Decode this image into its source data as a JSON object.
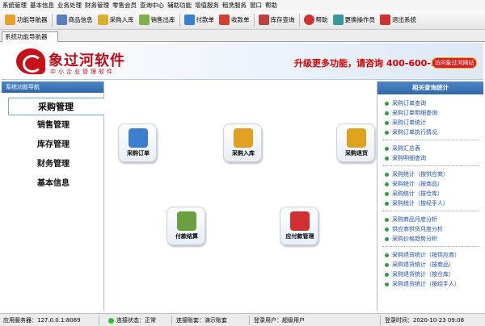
{
  "menu": [
    "系统管理",
    "基本信息",
    "业务处理",
    "财务管理",
    "零售会员",
    "查询中心",
    "辅助功能",
    "增值服务",
    "租赁服务",
    "窗口",
    "帮助"
  ],
  "toolbar": [
    {
      "label": "功能导航器",
      "icon": "home-icon",
      "color": "#e8a030"
    },
    {
      "label": "商品信息",
      "icon": "product-list-icon",
      "color": "#5a7fc0"
    },
    {
      "label": "采购入库",
      "icon": "purchase-in-icon",
      "color": "#d8b030"
    },
    {
      "label": "销售出库",
      "icon": "sales-out-icon",
      "color": "#7fb04a"
    },
    {
      "label": "付款单",
      "icon": "payment-icon",
      "color": "#3a7fd0"
    },
    {
      "label": "收款单",
      "icon": "receipt-icon",
      "color": "#d04030"
    },
    {
      "label": "库存查询",
      "icon": "inventory-icon",
      "color": "#c04040"
    },
    {
      "label": "帮助",
      "icon": "help-icon",
      "color": "#d03030"
    },
    {
      "label": "更换操作员",
      "icon": "switch-user-icon",
      "color": "#3a9a9a"
    },
    {
      "label": "退出系统",
      "icon": "exit-icon",
      "color": "#d03030"
    }
  ],
  "tab": {
    "label": "系统功能导航器",
    "close": "×"
  },
  "banner": {
    "brand": "象过河软件",
    "subtitle": "中小企业管理软件",
    "promo": "升级更多功能，请咨询 400-600-1168",
    "visit_button": "访问象过河网站"
  },
  "nav": {
    "header": "系统功能导航",
    "items": [
      "采购管理",
      "销售管理",
      "库存管理",
      "财务管理",
      "基本信息"
    ]
  },
  "workspace": {
    "icons": [
      {
        "label": "采购订单",
        "icon": "purchase-order-icon",
        "color": "#3a7fd0"
      },
      {
        "label": "采购入库",
        "icon": "purchase-in-icon",
        "color": "#e0a020"
      },
      {
        "label": "采购退货",
        "icon": "purchase-return-icon",
        "color": "#e0a020"
      },
      {
        "label": "付款结算",
        "icon": "payment-settle-icon",
        "color": "#6aa040"
      },
      {
        "label": "应付款管理",
        "icon": "payable-icon",
        "color": "#d03030"
      }
    ]
  },
  "right_panel": {
    "header": "相关查询统计",
    "groups": [
      [
        "采购订单查询",
        "采购订单明细查询",
        "采购订单统计",
        "采购订单执行情况"
      ],
      [
        "采购汇总表",
        "采购明细查询"
      ],
      [
        "采购统计（按供应商）",
        "采购统计（按商品）",
        "采购统计（按仓库）",
        "采购统计（按经手人）"
      ],
      [
        "采购商品月度分析",
        "供应商供货月度分析",
        "采购价格趋势分析"
      ],
      [
        "采购退货统计（按供应商）",
        "采购退货统计（按商品）",
        "采购退货统计（按仓库）",
        "采购退货统计（按经手人）"
      ]
    ]
  },
  "status": {
    "server_label": "应用服务器：",
    "server_value": "127.0.0.1:8089",
    "conn_label": "连接状态：",
    "conn_value": "正常",
    "account_label": "连接账套：",
    "account_value": "演示账套",
    "user_label": "登录用户：",
    "user_value": "超级用户",
    "time_label": "登录时间：",
    "time_value": "2020-10-23 09:08"
  }
}
